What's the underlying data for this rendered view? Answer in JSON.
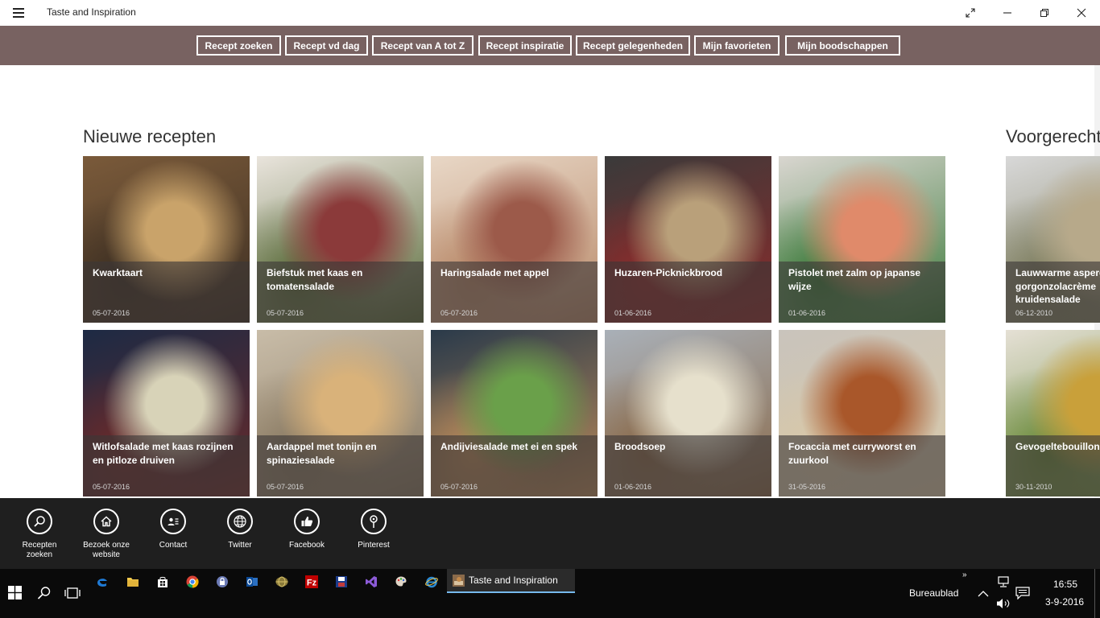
{
  "window": {
    "title": "Taste and Inspiration"
  },
  "nav": [
    "Recept zoeken",
    "Recept vd dag",
    "Recept van A tot Z",
    "Recept inspiratie",
    "Recept gelegenheden",
    "Mijn favorieten",
    "Mijn boodschappen"
  ],
  "sections": [
    {
      "title": "Nieuwe recepten",
      "tiles": [
        {
          "title": "Kwarktaart",
          "date": "05-07-2016",
          "colors": [
            "#7a5a3a",
            "#c9a36a",
            "#3d2f22"
          ]
        },
        {
          "title": "Biefstuk met kaas en tomatensalade",
          "date": "05-07-2016",
          "colors": [
            "#e9e4dc",
            "#8b3a3a",
            "#5a6b3a"
          ]
        },
        {
          "title": "Haringsalade met appel",
          "date": "05-07-2016",
          "colors": [
            "#e8d7c6",
            "#9c5a4a",
            "#b98a6a"
          ]
        },
        {
          "title": "Huzaren-Picknickbrood",
          "date": "01-06-2016",
          "colors": [
            "#3a3a3a",
            "#b9a07a",
            "#8b2b2b"
          ]
        },
        {
          "title": "Pistolet met zalm op japanse wijze",
          "date": "01-06-2016",
          "colors": [
            "#d9d6d0",
            "#e08a6a",
            "#3c7a3a"
          ]
        },
        {
          "title": "Witlofsalade met kaas rozijnen en pitloze druiven",
          "date": "05-07-2016",
          "colors": [
            "#1d2a44",
            "#d8d3b8",
            "#6a2a2a"
          ]
        },
        {
          "title": "Aardappel met tonijn en spinaziesalade",
          "date": "05-07-2016",
          "colors": [
            "#c8bca8",
            "#d9b27a",
            "#8a7a62"
          ]
        },
        {
          "title": "Andijviesalade met ei en spek",
          "date": "05-07-2016",
          "colors": [
            "#2a3a4a",
            "#6aa04a",
            "#b98a5a"
          ]
        },
        {
          "title": "Broodsoep",
          "date": "01-06-2016",
          "colors": [
            "#a9b0b8",
            "#e6e0cc",
            "#8a6a4a"
          ]
        },
        {
          "title": "Focaccia met curryworst en zuurkool",
          "date": "31-05-2016",
          "colors": [
            "#c9c4bc",
            "#a9572a",
            "#d8c8a8"
          ]
        }
      ]
    },
    {
      "title": "Voorgerecht",
      "tiles": [
        {
          "title": "Lauwwarme asperg gorgonzolacrème kruidensalade",
          "date": "06-12-2010",
          "colors": [
            "#d8d8d8",
            "#b7a98a",
            "#7a7a5a"
          ]
        },
        {
          "title": "Gevogeltebouillon sla",
          "date": "30-11-2010",
          "colors": [
            "#e5e0d5",
            "#c9a03a",
            "#6a8a3a"
          ]
        }
      ]
    }
  ],
  "appbar": [
    {
      "icon": "search-icon",
      "label": "Recepten zoeken"
    },
    {
      "icon": "home-icon",
      "label": "Bezoek onze website"
    },
    {
      "icon": "contact-card-icon",
      "label": "Contact"
    },
    {
      "icon": "globe-icon",
      "label": "Twitter"
    },
    {
      "icon": "thumbs-up-icon",
      "label": "Facebook"
    },
    {
      "icon": "map-pin-icon",
      "label": "Pinterest"
    }
  ],
  "taskbar": {
    "active_app": "Taste and Inspiration",
    "desktop_label": "Bureaublad",
    "time": "16:55",
    "date": "3-9-2016"
  }
}
